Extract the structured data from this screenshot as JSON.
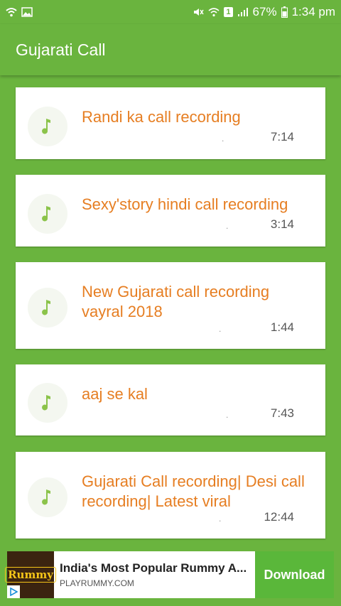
{
  "status_bar": {
    "battery": "67%",
    "time": "1:34 pm",
    "sim_badge": "1",
    "icons": [
      "wifi-icon",
      "image-icon",
      "mute-icon",
      "wifi-calling-icon",
      "sim-icon",
      "signal-icon",
      "battery-icon"
    ]
  },
  "app_bar": {
    "title": "Gujarati Call"
  },
  "recordings": [
    {
      "title": "Randi ka call recording",
      "dot": ".",
      "duration": "7:14",
      "icon": "music-note-icon"
    },
    {
      "title": "Sexy'story hindi call recording",
      "dot": ".",
      "duration": "3:14",
      "icon": "music-note-icon"
    },
    {
      "title": "New Gujarati call recording vayral 2018",
      "dot": ".",
      "duration": "1:44",
      "icon": "music-note-icon"
    },
    {
      "title": "aaj se kal",
      "dot": ".",
      "duration": "7:43",
      "icon": "music-note-icon"
    },
    {
      "title": "Gujarati Call recording| Desi call recording| Latest viral",
      "dot": ".",
      "duration": "12:44",
      "icon": "music-note-icon"
    }
  ],
  "ad": {
    "logo_text": "Rummy",
    "headline": "India's Most Popular Rummy A...",
    "url": "PLAYRUMMY.COM",
    "button": "Download"
  },
  "colors": {
    "primary": "#6ab43e",
    "title_text": "#e67e22",
    "icon_tint": "#8bc34a",
    "ad_button": "#5ab73a"
  }
}
